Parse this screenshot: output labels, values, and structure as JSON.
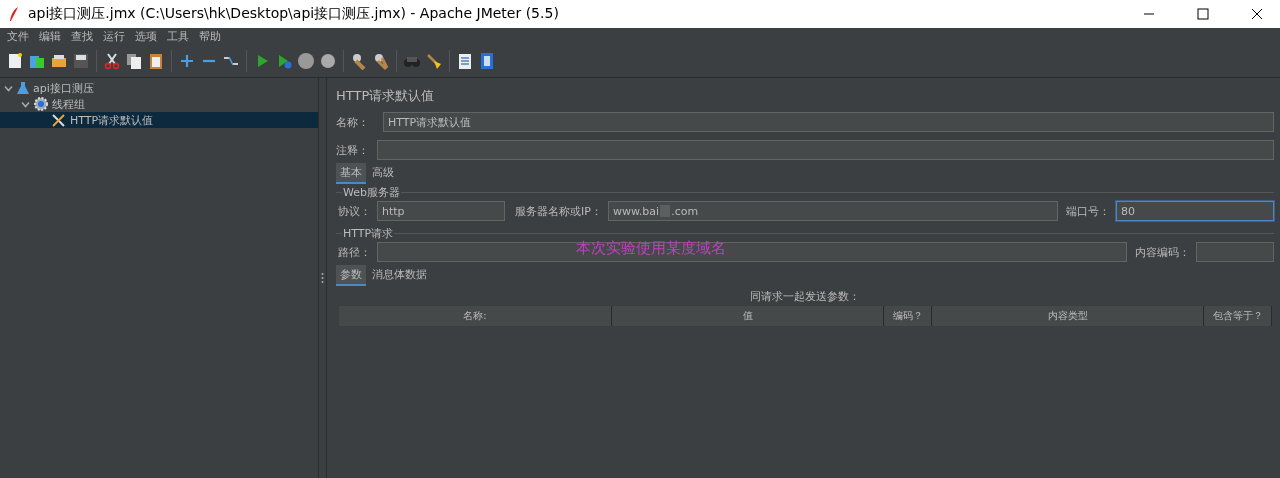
{
  "window": {
    "title": "api接口测压.jmx (C:\\Users\\hk\\Desktop\\api接口测压.jmx) - Apache JMeter (5.5)"
  },
  "menu": [
    "文件",
    "编辑",
    "查找",
    "运行",
    "选项",
    "工具",
    "帮助"
  ],
  "tree": [
    {
      "label": "api接口测压",
      "kind": "plan",
      "expanded": true,
      "selected": false,
      "children": [
        {
          "label": "线程组",
          "kind": "group",
          "expanded": true,
          "selected": false,
          "children": [
            {
              "label": "HTTP请求默认值",
              "kind": "config",
              "selected": true
            }
          ]
        }
      ]
    }
  ],
  "panel": {
    "title": "HTTP请求默认值",
    "name_label": "名称：",
    "name_value": "HTTP请求默认值",
    "comment_label": "注释：",
    "tabs": [
      {
        "label": "基本",
        "selected": true
      },
      {
        "label": "高级",
        "selected": false
      }
    ],
    "web_server": {
      "legend": "Web服务器",
      "protocol_label": "协议：",
      "protocol_value": "http",
      "server_label": "服务器名称或IP：",
      "server_value_start": "www.bai",
      "server_value_end": ".com",
      "server_redacted": true,
      "port_label": "端口号：",
      "port_value": "80",
      "port_focused": true
    },
    "http_request": {
      "legend": "HTTP请求",
      "path_label": "路径：",
      "encoding_label": "内容编码："
    },
    "annotation": "本次实验使用某度域名",
    "sub_tabs": [
      {
        "label": "参数",
        "selected": true
      },
      {
        "label": "消息体数据",
        "selected": false
      }
    ],
    "table": {
      "caption": "同请求一起发送参数：",
      "columns": [
        "名称:",
        "值",
        "编码？",
        "内容类型",
        "包含等于？"
      ]
    }
  }
}
